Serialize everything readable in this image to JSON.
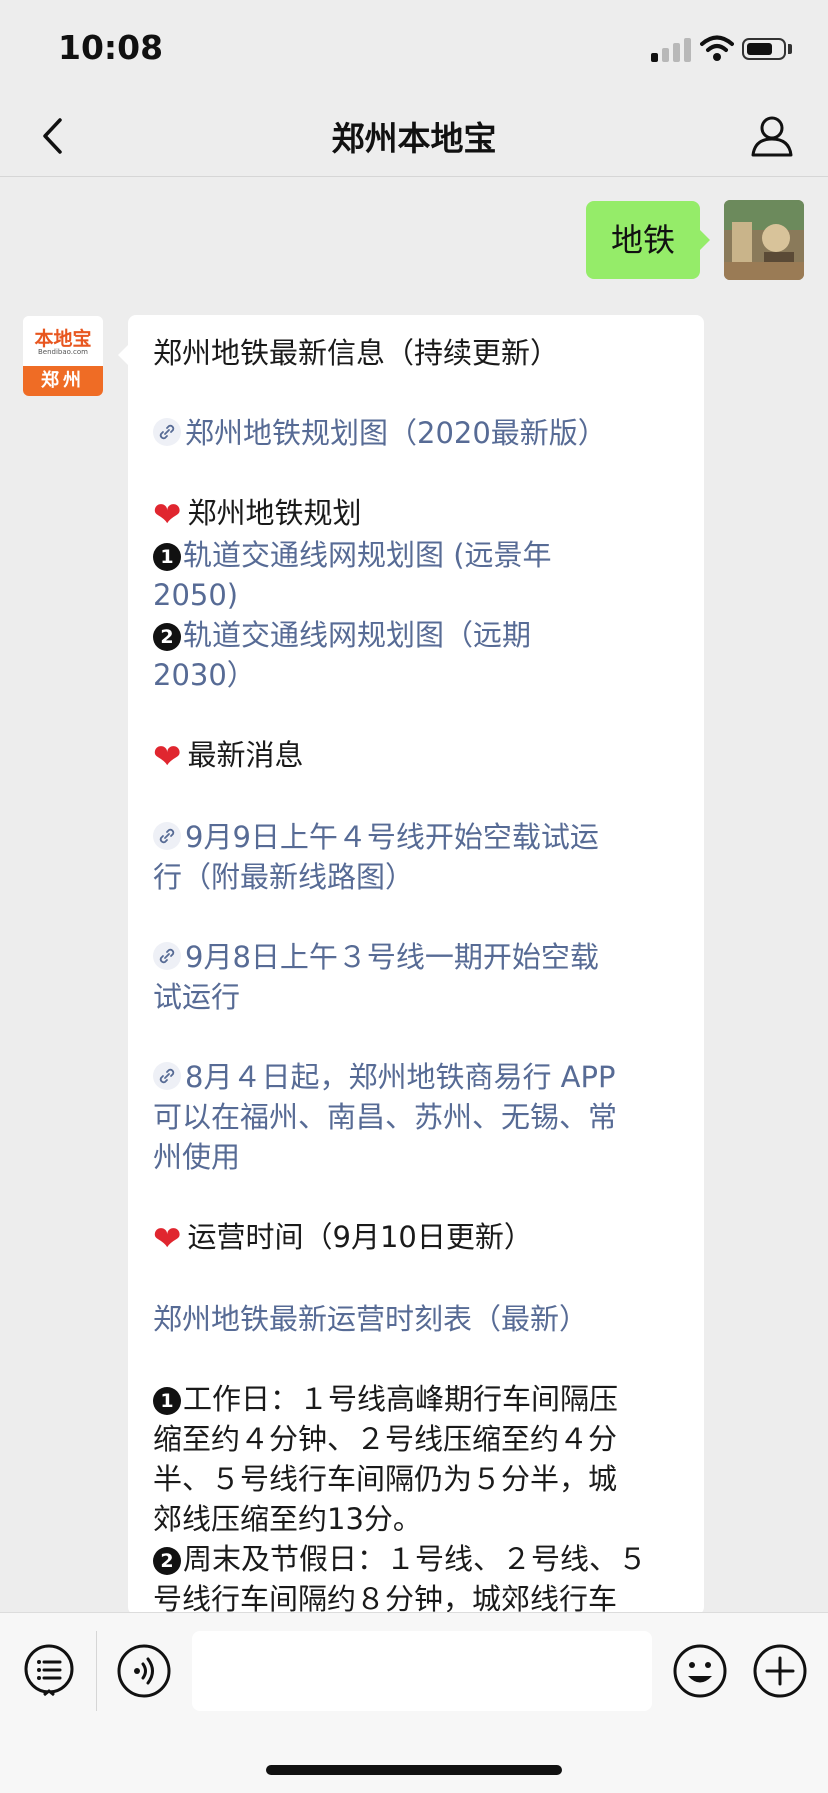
{
  "status": {
    "time": "10:08"
  },
  "nav": {
    "title": "郑州本地宝"
  },
  "user_message": {
    "text": "地铁"
  },
  "bot": {
    "avatar_brand": "本地宝",
    "avatar_domain": "Bendibao.com",
    "avatar_city": "郑州"
  },
  "message": {
    "title": "郑州地铁最新信息（持续更新）",
    "link_map": "郑州地铁规划图（2020最新版）",
    "section_plan": "郑州地铁规划",
    "plan_item1_badge": "❶",
    "plan_item1_a": "轨道交通线网规划图 (远景年",
    "plan_item1_b": "2050)",
    "plan_item2_badge": "❷",
    "plan_item2_a": "轨道交通线网规划图（远期",
    "plan_item2_b": "2030）",
    "section_news": "最新消息",
    "news1_a": "9月9日上午４号线开始空载试运",
    "news1_b": "行（附最新线路图）",
    "news2_a": "9月8日上午３号线一期开始空载",
    "news2_b": "试运行",
    "news3_a": "8月４日起，郑州地铁商易行 APP",
    "news3_b": "可以在福州、南昌、苏州、无锡、常",
    "news3_c": "州使用",
    "section_hours": "运营时间（9月10日更新）",
    "link_timetable": "郑州地铁最新运营时刻表（最新）",
    "workday_badge": "❶",
    "workday_a": "工作日：１号线高峰期行车间隔压",
    "workday_b": "缩至约４分钟、２号线压缩至约４分",
    "workday_c": "半、５号线行车间隔仍为５分半，城",
    "workday_d": "郊线压缩至约13分。",
    "weekend_badge": "❷",
    "weekend_a": "周末及节假日：１号线、２号线、５",
    "weekend_b": "号线行车间隔约８分钟，城郊线行车"
  },
  "input": {
    "placeholder": ""
  },
  "colors": {
    "link": "#576b95",
    "user_bubble": "#95ec69",
    "heart": "#e0262f",
    "background": "#ededed"
  }
}
